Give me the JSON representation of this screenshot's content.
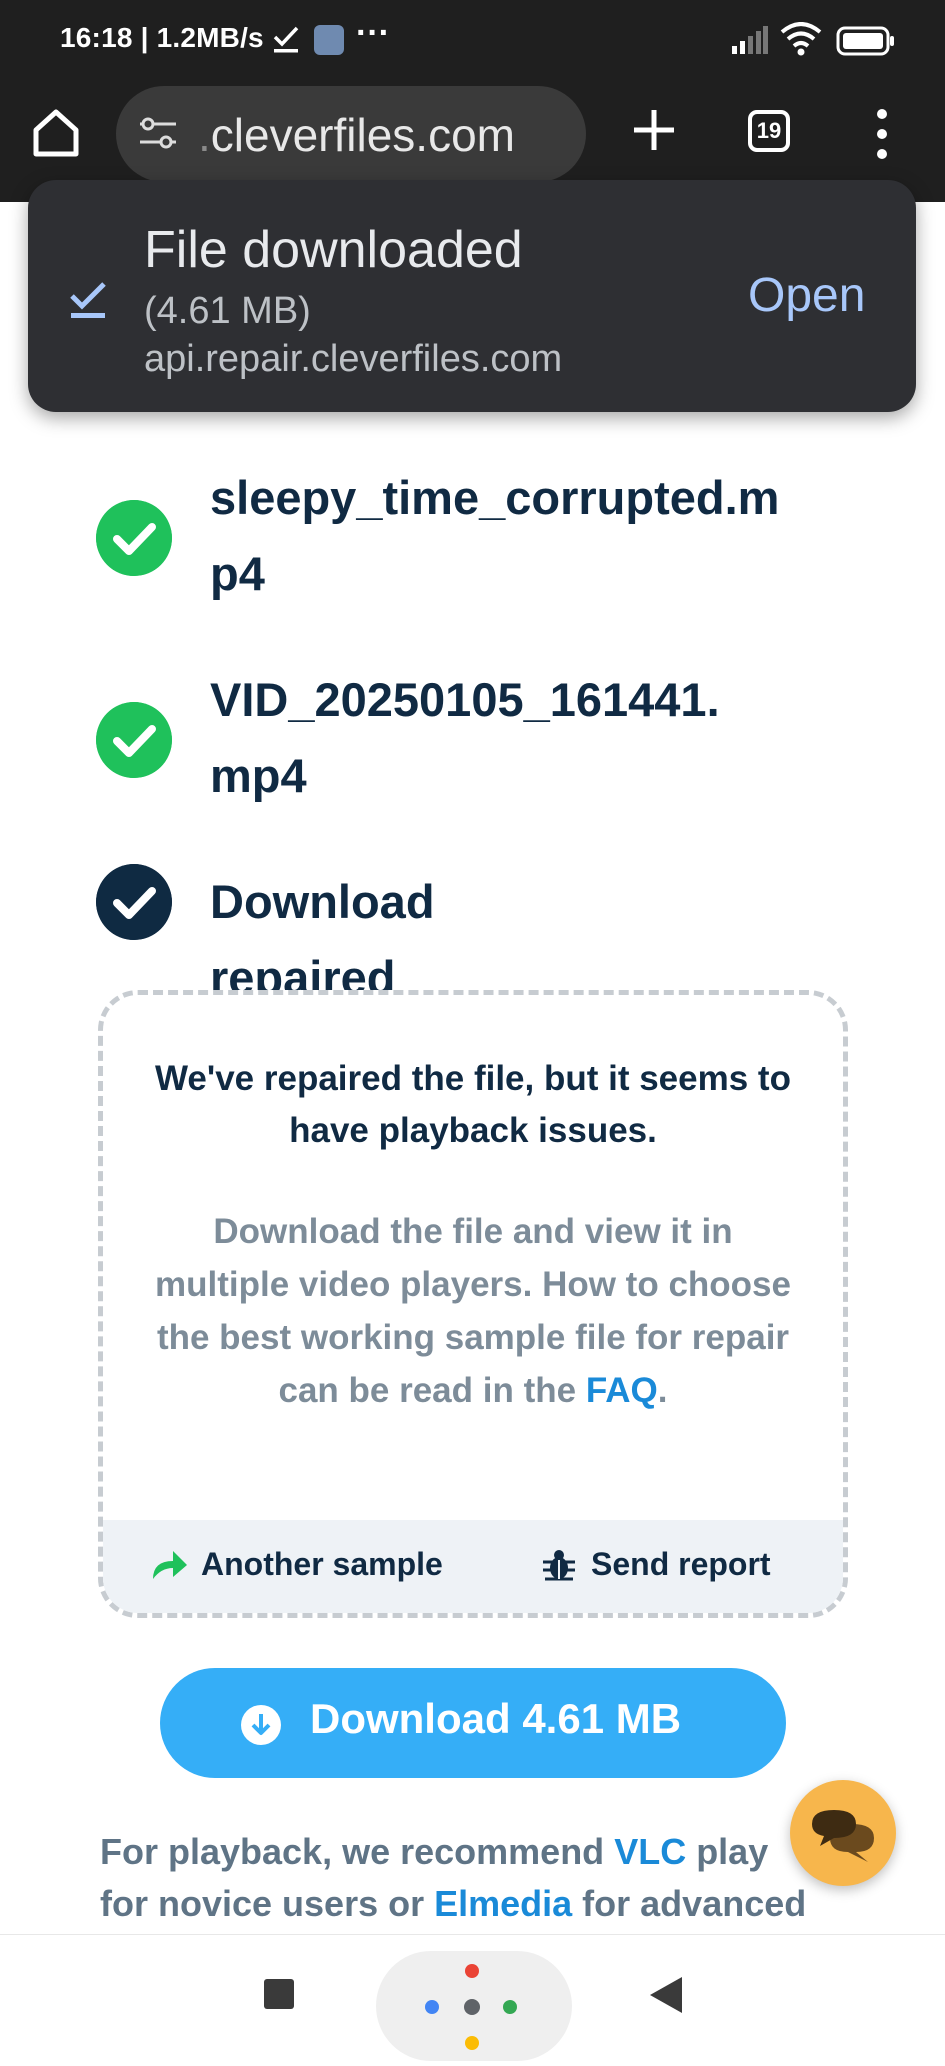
{
  "status_bar": {
    "time": "16:18 | 1.2MB/s",
    "icons": [
      "download-done-icon",
      "app-icon",
      "more-dots-icon",
      "signal-icon",
      "wifi-icon",
      "battery-icon"
    ],
    "more": "···"
  },
  "browser": {
    "url_dim_prefix": ".",
    "url": "cleverfiles.com",
    "tab_count": "19",
    "icons": [
      "home-icon",
      "site-settings-icon",
      "new-tab-icon",
      "tab-switcher-icon",
      "overflow-menu-icon"
    ]
  },
  "snackbar": {
    "title": "File downloaded",
    "size": "(4.61 MB)",
    "host": "api.repair.cleverfiles.com",
    "action": "Open",
    "icon": "download-done-icon"
  },
  "steps": [
    {
      "line1": "sleepy_time_corrupted.m",
      "line2": "p4",
      "status": "done"
    },
    {
      "line1": "VID_20250105_161441.",
      "line2": "mp4",
      "status": "done"
    },
    {
      "line1": "Download repaired file",
      "line2": "",
      "status": "current"
    }
  ],
  "notice": {
    "title": "We've repaired the file, but it seems to have playback issues.",
    "body": "Download the file and view it in multiple video players. How to choose the best working sample file for repair can be read in the",
    "faq_link": "FAQ",
    "faq_suffix": ".",
    "another_sample": "Another sample",
    "send_report": "Send report"
  },
  "download": {
    "label": "Download 4.61 MB"
  },
  "recommendation": {
    "prefix": "For playback, we recommend ",
    "vlc": "VLC",
    "mid": " play",
    "line2_prefix": "for novice users or ",
    "elmedia": "Elmedia",
    "line2_suffix": " for advanced"
  },
  "colors": {
    "accent_blue": "#35aef7",
    "success_green": "#1fc15b",
    "navy": "#0f2a42",
    "link": "#1a8ad8",
    "chat_fab": "#f7b64c"
  }
}
